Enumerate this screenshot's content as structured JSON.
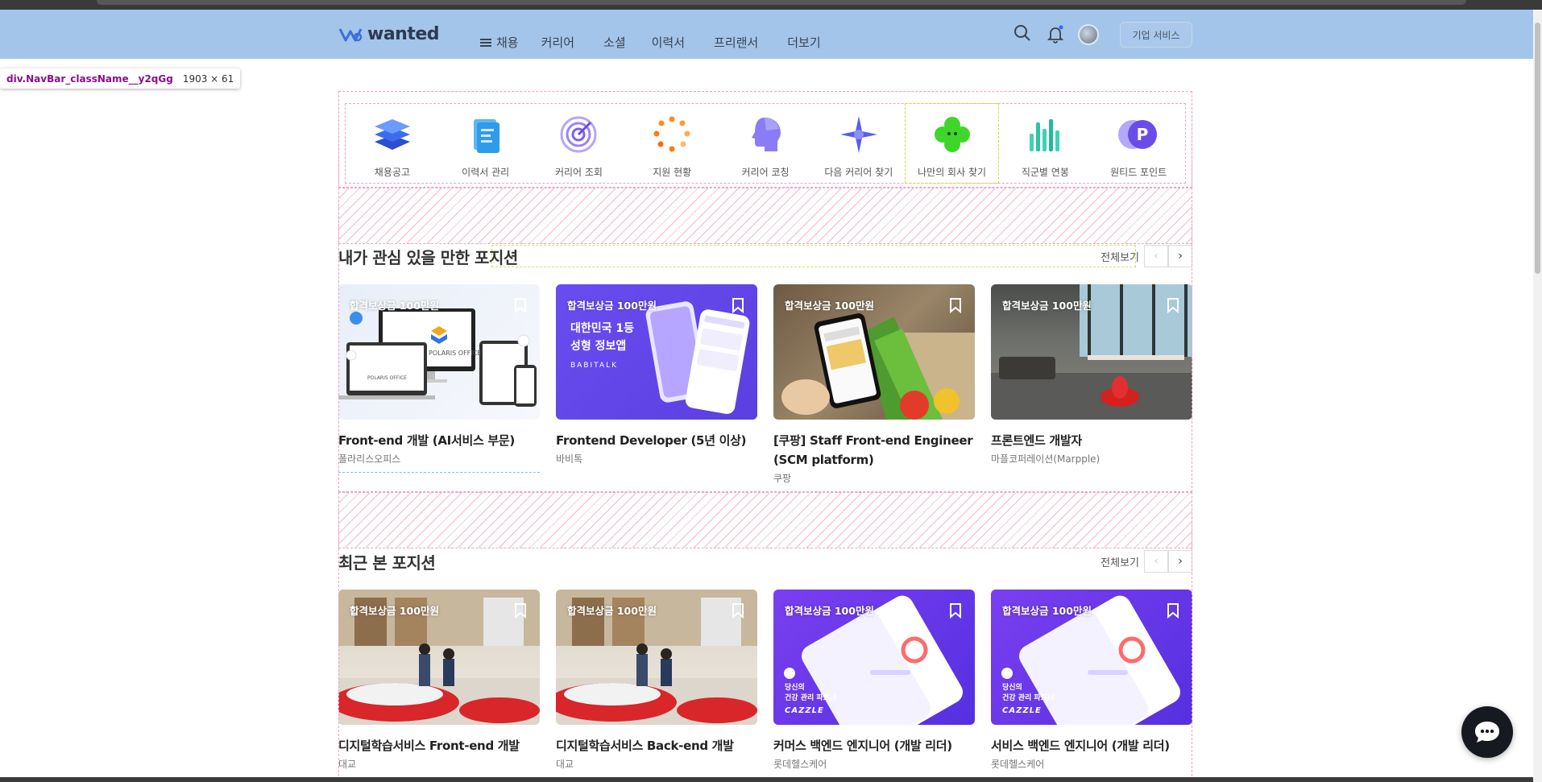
{
  "nav": {
    "logo": "wanted",
    "menu": [
      "채용",
      "커리어",
      "소셜",
      "이력서",
      "프리랜서",
      "더보기"
    ],
    "business_button": "기업 서비스"
  },
  "tooltip": {
    "name": "div.NavBar_className__y2qGg",
    "size": "1903 × 61"
  },
  "quick_menu": [
    "채용공고",
    "이력서 관리",
    "커리어 조회",
    "지원 현황",
    "커리어 코칭",
    "다음 커리어 찾기",
    "나만의 회사 찾기",
    "직군별 연봉",
    "원티드 포인트"
  ],
  "section1": {
    "title": "내가 관심 있을 만한 포지션",
    "view_all": "전체보기",
    "cards": [
      {
        "badge": "합격보상금 100만원",
        "title": "Front-end 개발 (AI서비스 부문)",
        "company": "폴라리스오피스"
      },
      {
        "badge": "합격보상금 100만원",
        "title": "Frontend Developer (5년 이상)",
        "company": "바비톡",
        "image_text1": "대한민국 1등",
        "image_text2": "성형 정보앱",
        "image_brand": "BABITALK"
      },
      {
        "badge": "합격보상금 100만원",
        "title": "[쿠팡] Staff Front-end Engineer (SCM platform)",
        "company": "쿠팡"
      },
      {
        "badge": "합격보상금 100만원",
        "title": "프론트엔드 개발자",
        "company": "마플코퍼레이션(Marpple)"
      }
    ]
  },
  "section2": {
    "title": "최근 본 포지션",
    "view_all": "전체보기",
    "cards": [
      {
        "badge": "합격보상금 100만원",
        "title": "디지털학습서비스 Front-end 개발",
        "company": "대교"
      },
      {
        "badge": "합격보상금 100만원",
        "title": "디지털학습서비스 Back-end 개발",
        "company": "대교"
      },
      {
        "badge": "합격보상금 100만원",
        "title": "커머스 백엔드 엔지니어 (개발 리더)",
        "company": "롯데헬스케어",
        "image_text1": "당신의",
        "image_text2": "건강 관리 파트너",
        "image_brand": "CAZZLE"
      },
      {
        "badge": "합격보상금 100만원",
        "title": "서비스 백엔드 엔지니어 (개발 리더)",
        "company": "롯데헬스케어",
        "image_text1": "당신의",
        "image_text2": "건강 관리 파트너",
        "image_brand": "CAZZLE"
      }
    ]
  },
  "colors": {
    "nav_bg": "#a3c5ea",
    "accent_purple": "#6b4ef0",
    "chat_bg": "#16191f"
  }
}
